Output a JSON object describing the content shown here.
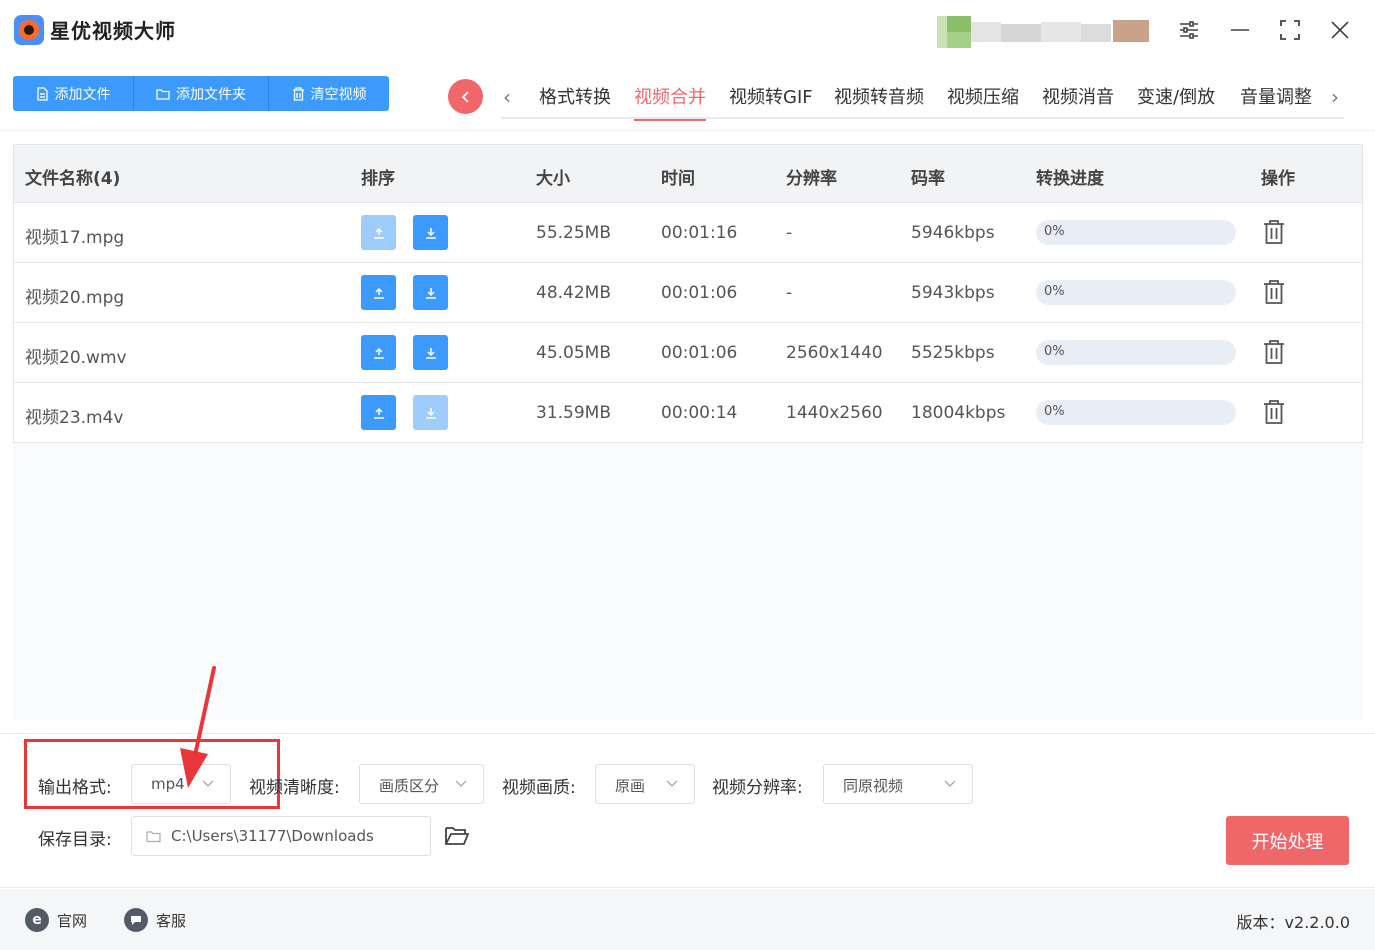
{
  "app": {
    "title": "星优视频大师"
  },
  "toolbar": {
    "add_file": "添加文件",
    "add_folder": "添加文件夹",
    "clear": "清空视频"
  },
  "tabs": [
    {
      "label": "格式转换",
      "active": false
    },
    {
      "label": "视频合并",
      "active": true
    },
    {
      "label": "视频转GIF",
      "active": false
    },
    {
      "label": "视频转音频",
      "active": false
    },
    {
      "label": "视频压缩",
      "active": false
    },
    {
      "label": "视频消音",
      "active": false
    },
    {
      "label": "变速/倒放",
      "active": false
    },
    {
      "label": "音量调整",
      "active": false
    }
  ],
  "table": {
    "headers": {
      "name": "文件名称(4)",
      "sort": "排序",
      "size": "大小",
      "time": "时间",
      "resolution": "分辨率",
      "bitrate": "码率",
      "progress": "转换进度",
      "action": "操作"
    },
    "rows": [
      {
        "name": "视频17.mpg",
        "size": "55.25MB",
        "time": "00:01:16",
        "resolution": "-",
        "bitrate": "5946kbps",
        "progress": "0%",
        "progress_value": 0,
        "up_enabled": false,
        "down_enabled": true
      },
      {
        "name": "视频20.mpg",
        "size": "48.42MB",
        "time": "00:01:06",
        "resolution": "-",
        "bitrate": "5943kbps",
        "progress": "0%",
        "progress_value": 0,
        "up_enabled": true,
        "down_enabled": true
      },
      {
        "name": "视频20.wmv",
        "size": "45.05MB",
        "time": "00:01:06",
        "resolution": "2560x1440",
        "bitrate": "5525kbps",
        "progress": "0%",
        "progress_value": 0,
        "up_enabled": true,
        "down_enabled": true
      },
      {
        "name": "视频23.m4v",
        "size": "31.59MB",
        "time": "00:00:14",
        "resolution": "1440x2560",
        "bitrate": "18004kbps",
        "progress": "0%",
        "progress_value": 0,
        "up_enabled": true,
        "down_enabled": false
      }
    ]
  },
  "settings": {
    "output_format_label": "输出格式:",
    "output_format_value": "mp4",
    "clarity_label": "视频清晰度:",
    "clarity_value": "画质区分",
    "quality_label": "视频画质:",
    "quality_value": "原画",
    "resolution_label": "视频分辨率:",
    "resolution_value": "同原视频",
    "save_dir_label": "保存目录:",
    "save_dir_value": "C:\\Users\\31177\\Downloads",
    "start_button": "开始处理"
  },
  "footer": {
    "website": "官网",
    "support": "客服",
    "version": "版本：v2.2.0.0"
  },
  "colors": {
    "primary": "#3b9afc",
    "primary_disabled": "#9dccfd",
    "accent": "#f0676a",
    "highlight": "#e8363b"
  }
}
